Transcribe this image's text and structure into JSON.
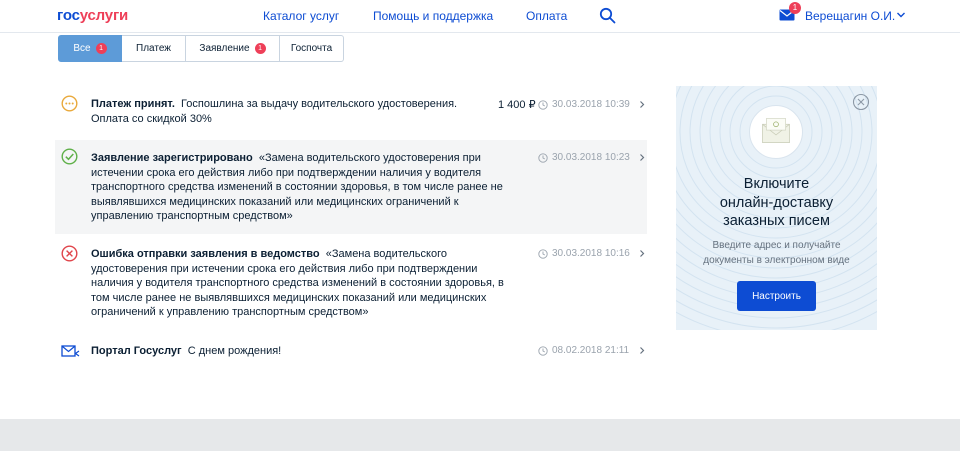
{
  "header": {
    "logo_part1": "гос",
    "logo_part2": "услуги",
    "nav": [
      "Каталог услуг",
      "Помощь и поддержка",
      "Оплата"
    ],
    "mail_badge": "1",
    "user_name": "Верещагин О.И."
  },
  "tabs": [
    {
      "label": "Все",
      "badge": "1"
    },
    {
      "label": "Платеж",
      "badge": ""
    },
    {
      "label": "Заявление",
      "badge": "1"
    },
    {
      "label": "Госпочта",
      "badge": ""
    }
  ],
  "feed": [
    {
      "title": "Платеж принят.",
      "lines": [
        "Госпошлина за выдачу водительского удостоверения.",
        "Оплата со скидкой 30%"
      ],
      "amount": "1 400 ₽",
      "date": "30.03.2018 10:39",
      "icon": "pending-icon"
    },
    {
      "title": "Заявление зарегистрировано",
      "lines": [
        "«Замена водительского удостоверения при",
        "истечении срока его действия либо при подтверждении наличия у водителя",
        "транспортного средства изменений в состоянии здоровья, в том числе ранее не",
        "выявлявшихся медицинских показаний или медицинских ограничений к",
        "управлению транспортным средством»"
      ],
      "date": "30.03.2018 10:23",
      "icon": "check-icon"
    },
    {
      "title": "Ошибка отправки заявления в ведомство",
      "lines": [
        "«Замена водительского",
        "удостоверения при истечении срока его действия либо при подтверждении",
        "наличия у водителя транспортного средства изменений в состоянии здоровья, в",
        "том числе ранее не выявлявшихся медицинских показаний или медицинских",
        "ограничений к управлению транспортным средством»"
      ],
      "date": "30.03.2018 10:16",
      "icon": "error-icon"
    },
    {
      "title": "Портал Госуслуг",
      "lines": [
        "С днем рождения!"
      ],
      "date": "08.02.2018 21:11",
      "icon": "envelope-icon"
    }
  ],
  "promo": {
    "title_lines": [
      "Включите",
      "онлайн-доставку",
      "заказных писем"
    ],
    "text_lines": [
      "Введите адрес и получайте",
      "документы в электронном виде"
    ],
    "button": "Настроить"
  },
  "colors": {
    "brand_blue": "#0d4cd3",
    "brand_red": "#ee3f58",
    "tab_active": "#5d9bd8",
    "success": "#5fb049",
    "pending": "#e9a93b",
    "error": "#e0454b"
  }
}
